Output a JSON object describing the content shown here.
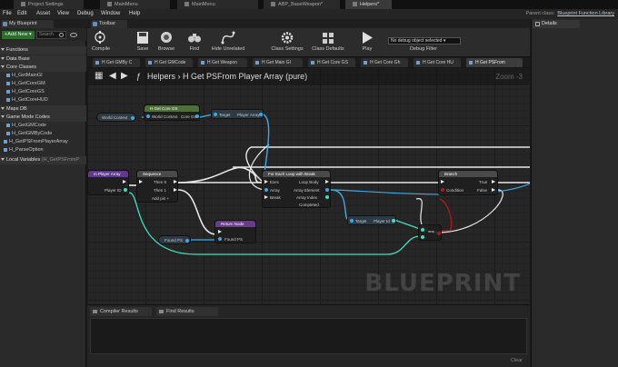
{
  "tabs": [
    {
      "label": "Project Settings"
    },
    {
      "label": "MainMenu"
    },
    {
      "label": "MainMenu"
    },
    {
      "label": "ABP_BaseWeapon*"
    },
    {
      "label": "Helpers*"
    }
  ],
  "menu": {
    "items": [
      "File",
      "Edit",
      "Asset",
      "View",
      "Debug",
      "Window",
      "Help"
    ],
    "parent_class_label": "Parent class:",
    "parent_class_value": "Blueprint Function Library"
  },
  "panels": {
    "my_blueprint": "My Blueprint",
    "toolbar": "Toolbar",
    "details": "Details"
  },
  "left": {
    "add_new": "+Add New ▾",
    "search_placeholder": "Search",
    "functions_header": "Functions",
    "tree": [
      {
        "label": "Data Base",
        "kind": "cat"
      },
      {
        "label": "Core Classes",
        "kind": "cat"
      },
      {
        "label": "H_GetMainGI",
        "kind": "fn"
      },
      {
        "label": "H_GetCoreGM",
        "kind": "fn"
      },
      {
        "label": "H_GetCoreGS",
        "kind": "fn"
      },
      {
        "label": "H_GetCoreHUD",
        "kind": "fn"
      },
      {
        "label": "Maps DB",
        "kind": "cat"
      },
      {
        "label": "Game Mode Codes",
        "kind": "cat"
      },
      {
        "label": "H_GetGMCode",
        "kind": "fn"
      },
      {
        "label": "H_GetGMByCode",
        "kind": "fn"
      },
      {
        "label": "H_GetPSFromPlayerArray",
        "kind": "fn"
      },
      {
        "label": "H_ParseOption",
        "kind": "fn"
      }
    ],
    "local_vars": "Local Variables",
    "local_vars_scope": "(H_GetPSFromP"
  },
  "toolbar": {
    "compile": "Compile",
    "save": "Save",
    "browse": "Browse",
    "find": "Find",
    "hide_unrelated": "Hide Unrelated",
    "class_settings": "Class Settings",
    "class_defaults": "Class Defaults",
    "play": "Play",
    "debug_object": "No debug object selected ▾",
    "debug_filter": "Debug Filter"
  },
  "function_tabs": [
    {
      "label": "H Get GMBy C",
      "active": false
    },
    {
      "label": "H Get GMCode",
      "active": false
    },
    {
      "label": "H Get Weapon",
      "active": false
    },
    {
      "label": "H Get Main GI",
      "active": false
    },
    {
      "label": "H Get Core GS",
      "active": false
    },
    {
      "label": "H Get Core Gh",
      "active": false
    },
    {
      "label": "H Get Core HU",
      "active": false
    },
    {
      "label": "H Get PSFrom",
      "active": true
    }
  ],
  "graph": {
    "breadcrumb_root": "Helpers",
    "breadcrumb_sep": "›",
    "breadcrumb_leaf": "H Get PSFrom Player Array (pure)",
    "zoom": "Zoom -3",
    "watermark": "BLUEPRINT",
    "nodes": {
      "get_core_gs": {
        "title": "H Get Core GS",
        "in": "World Context",
        "out": "Core GS"
      },
      "world_context": {
        "label": "World Context"
      },
      "player_array_get": {
        "in": "Target",
        "out": "Player Array"
      },
      "entry": {
        "title": "m Player Array",
        "pin": "Player ID"
      },
      "sequence": {
        "title": "Sequence",
        "then0": "Then 0",
        "then1": "Then 1",
        "add": "Add pin +"
      },
      "return_node": {
        "title": "Return Node",
        "pin": "Found PS"
      },
      "found_ps": {
        "label": "Found PS"
      },
      "foreach": {
        "title": "For Each Loop with Break",
        "exec": "Exec",
        "array": "Array",
        "break": "Break",
        "loop_body": "Loop Body",
        "array_element": "Array Element",
        "array_index": "Array Index",
        "completed": "Completed"
      },
      "branch": {
        "title": "Branch",
        "condition": "Condition",
        "true": "True",
        "false": "False"
      },
      "player_id": {
        "in": "Target",
        "out": "Player Id"
      },
      "equals": {
        "label": "=="
      }
    }
  },
  "bottom": {
    "compiler_results": "Compiler Results",
    "find_results": "Find Results",
    "clear": "Clear"
  }
}
